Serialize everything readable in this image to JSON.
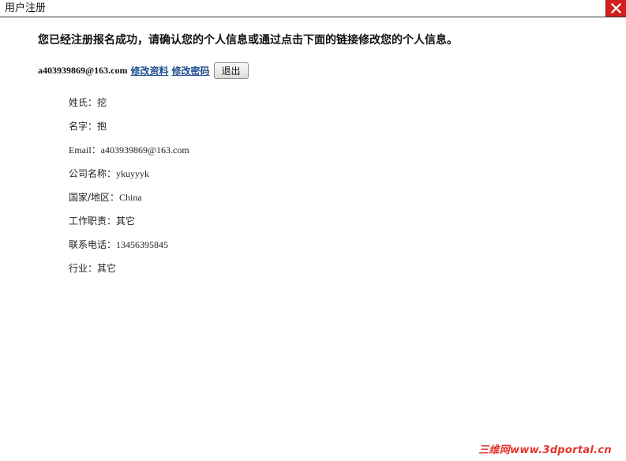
{
  "window": {
    "title": "用户注册",
    "close_icon": "close-icon"
  },
  "heading": "您已经注册报名成功，请确认您的个人信息或通过点击下面的链接修改您的个人信息。",
  "account": {
    "email": "a403939869@163.com",
    "edit_profile_label": "修改资料",
    "change_password_label": "修改密码",
    "logout_label": "退出"
  },
  "info": [
    {
      "label": "姓氏：",
      "value": "挖"
    },
    {
      "label": "名字：",
      "value": "抱"
    },
    {
      "label": "Email：",
      "value": "a403939869@163.com"
    },
    {
      "label": "公司名称：",
      "value": "ykuyyyk"
    },
    {
      "label": "国家/地区：",
      "value": "China"
    },
    {
      "label": "工作职责：",
      "value": "其它"
    },
    {
      "label": "联系电话：",
      "value": "13456395845"
    },
    {
      "label": "行业：",
      "value": "其它"
    }
  ],
  "watermark": "三维网www.3dportal.cn",
  "colors": {
    "close_button": "#d21f1f",
    "link": "#1f4f8f",
    "watermark": "#e3342b"
  }
}
